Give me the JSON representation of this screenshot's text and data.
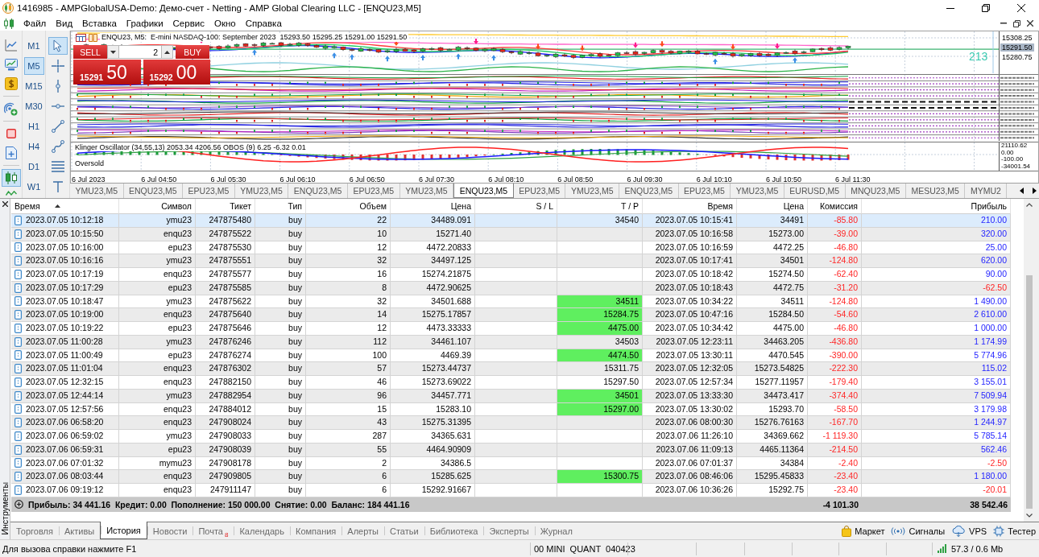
{
  "window": {
    "title": "1416985 - AMPGlobalUSA-Demo: Демо-счет - Netting - AMP Global Clearing LLC - [ENQU23,M5]"
  },
  "menu": [
    "Файл",
    "Вид",
    "Вставка",
    "Графики",
    "Сервис",
    "Окно",
    "Справка"
  ],
  "side_tools": [
    {
      "kind": "market-watch",
      "selected": false
    },
    {
      "kind": "data-window",
      "selected": false
    },
    {
      "kind": "trading",
      "selected": false
    },
    {
      "kind": "signals",
      "selected": false
    },
    {
      "kind": "stop",
      "selected": false
    },
    {
      "kind": "new-order",
      "selected": false
    },
    {
      "kind": "candles",
      "selected": true
    },
    {
      "kind": "oscillator",
      "selected": false
    }
  ],
  "timeframes": [
    {
      "label": "M1",
      "selected": false
    },
    {
      "label": "M5",
      "selected": true
    },
    {
      "label": "M15",
      "selected": false
    },
    {
      "label": "M30",
      "selected": false
    },
    {
      "label": "H1",
      "selected": false
    },
    {
      "label": "H4",
      "selected": false
    },
    {
      "label": "D1",
      "selected": false
    },
    {
      "label": "W1",
      "selected": false
    }
  ],
  "drawing_tools": [
    {
      "kind": "cursor",
      "selected": true
    },
    {
      "kind": "crosshair",
      "selected": false
    },
    {
      "kind": "vertical-line",
      "selected": false
    },
    {
      "kind": "horizontal-line",
      "selected": false
    },
    {
      "kind": "trend-line",
      "selected": false
    },
    {
      "kind": "polyline",
      "selected": false
    },
    {
      "kind": "parallel-lines",
      "selected": false
    },
    {
      "kind": "text",
      "selected": false
    }
  ],
  "chart": {
    "header": "ENQU23, M5:  E-mini NASDAQ-100: September 2023  15293.50 15295.25 15291.00 15291.50",
    "trade_panel": {
      "sell": "SELL",
      "volume": "2",
      "buy": "BUY",
      "bid": "15291",
      "bid_pips": "50",
      "ask": "15292",
      "ask_pips": "00"
    },
    "price_axis": [
      "15308.25",
      "15280.75"
    ],
    "current_price": "15291.50",
    "counter": "213",
    "oscillator": {
      "label": "Klinger Oscillator (34,55,13) 2053.34 4206.56 OBOS (9) 6.25 -6.32 0.01",
      "note": "Oversold",
      "axis": [
        "21110.62",
        "0.00",
        "-100.00",
        "-34001.54"
      ]
    },
    "time_axis": [
      "6 Jul 2023",
      "6 Jul 04:50",
      "6 Jul 05:30",
      "6 Jul 06:10",
      "6 Jul 06:50",
      "6 Jul 07:30",
      "6 Jul 08:10",
      "6 Jul 08:50",
      "6 Jul 09:30",
      "6 Jul 10:10",
      "6 Jul 10:50",
      "6 Jul 11:30"
    ]
  },
  "chart_tabs": [
    {
      "label": "YMU23,M5",
      "selected": false
    },
    {
      "label": "ENQU23,M5",
      "selected": false
    },
    {
      "label": "EPU23,M5",
      "selected": false
    },
    {
      "label": "YMU23,M5",
      "selected": false
    },
    {
      "label": "ENQU23,M5",
      "selected": false
    },
    {
      "label": "EPU23,M5",
      "selected": false
    },
    {
      "label": "YMU23,M5",
      "selected": false
    },
    {
      "label": "ENQU23,M5",
      "selected": true
    },
    {
      "label": "EPU23,M5",
      "selected": false
    },
    {
      "label": "YMU23,M5",
      "selected": false
    },
    {
      "label": "ENQU23,M5",
      "selected": false
    },
    {
      "label": "EPU23,M5",
      "selected": false
    },
    {
      "label": "YMU23,M5",
      "selected": false
    },
    {
      "label": "EURUSD,M5",
      "selected": false
    },
    {
      "label": "MNQU23,M5",
      "selected": false
    },
    {
      "label": "MESU23,M5",
      "selected": false
    },
    {
      "label": "MYMU2",
      "selected": false
    }
  ],
  "history": {
    "columns": [
      {
        "label": "Время",
        "sorted": true
      },
      {
        "label": "Символ",
        "sorted": false
      },
      {
        "label": "Тикет",
        "sorted": false
      },
      {
        "label": "Тип",
        "sorted": false
      },
      {
        "label": "Объем",
        "sorted": false
      },
      {
        "label": "Цена",
        "sorted": false
      },
      {
        "label": "S / L",
        "sorted": false
      },
      {
        "label": "T / P",
        "sorted": false
      },
      {
        "label": "Время",
        "sorted": false
      },
      {
        "label": "Цена",
        "sorted": false
      },
      {
        "label": "Комиссия",
        "sorted": false
      },
      {
        "label": "Прибыль",
        "sorted": false
      }
    ],
    "rows": [
      {
        "open_time": "2023.07.05 10:12:18",
        "symbol": "ymu23",
        "ticket": "247875480",
        "type": "buy",
        "volume": "22",
        "open_price": "34489.091",
        "tp": "34540",
        "close_time": "2023.07.05 10:15:41",
        "close_price": "34491",
        "commission": "-85.80",
        "profit": "210.00",
        "selected": true,
        "tp_hit": false,
        "loss": false
      },
      {
        "open_time": "2023.07.05 10:15:50",
        "symbol": "enqu23",
        "ticket": "247875522",
        "type": "buy",
        "volume": "10",
        "open_price": "15271.40",
        "close_time": "2023.07.05 10:16:58",
        "close_price": "15273.00",
        "commission": "-39.00",
        "profit": "320.00",
        "selected": false,
        "tp_hit": false,
        "loss": false
      },
      {
        "open_time": "2023.07.05 10:16:00",
        "symbol": "epu23",
        "ticket": "247875530",
        "type": "buy",
        "volume": "12",
        "open_price": "4472.20833",
        "close_time": "2023.07.05 10:16:59",
        "close_price": "4472.25",
        "commission": "-46.80",
        "profit": "25.00",
        "selected": false,
        "tp_hit": false,
        "loss": false
      },
      {
        "open_time": "2023.07.05 10:16:16",
        "symbol": "ymu23",
        "ticket": "247875551",
        "type": "buy",
        "volume": "32",
        "open_price": "34497.125",
        "close_time": "2023.07.05 10:17:41",
        "close_price": "34501",
        "commission": "-124.80",
        "profit": "620.00",
        "selected": false,
        "tp_hit": false,
        "loss": false
      },
      {
        "open_time": "2023.07.05 10:17:19",
        "symbol": "enqu23",
        "ticket": "247875577",
        "type": "buy",
        "volume": "16",
        "open_price": "15274.21875",
        "close_time": "2023.07.05 10:18:42",
        "close_price": "15274.50",
        "commission": "-62.40",
        "profit": "90.00",
        "selected": false,
        "tp_hit": false,
        "loss": false
      },
      {
        "open_time": "2023.07.05 10:17:29",
        "symbol": "epu23",
        "ticket": "247875585",
        "type": "buy",
        "volume": "8",
        "open_price": "4472.90625",
        "close_time": "2023.07.05 10:18:43",
        "close_price": "4472.75",
        "commission": "-31.20",
        "profit": "-62.50",
        "selected": false,
        "tp_hit": false,
        "loss": true
      },
      {
        "open_time": "2023.07.05 10:18:47",
        "symbol": "ymu23",
        "ticket": "247875622",
        "type": "buy",
        "volume": "32",
        "open_price": "34501.688",
        "tp": "34511",
        "close_time": "2023.07.05 10:34:22",
        "close_price": "34511",
        "commission": "-124.80",
        "profit": "1 490.00",
        "selected": false,
        "tp_hit": true,
        "loss": false
      },
      {
        "open_time": "2023.07.05 10:19:00",
        "symbol": "enqu23",
        "ticket": "247875640",
        "type": "buy",
        "volume": "14",
        "open_price": "15275.17857",
        "tp": "15284.75",
        "close_time": "2023.07.05 10:47:16",
        "close_price": "15284.50",
        "commission": "-54.60",
        "profit": "2 610.00",
        "selected": false,
        "tp_hit": true,
        "loss": false
      },
      {
        "open_time": "2023.07.05 10:19:22",
        "symbol": "epu23",
        "ticket": "247875646",
        "type": "buy",
        "volume": "12",
        "open_price": "4473.33333",
        "tp": "4475.00",
        "close_time": "2023.07.05 10:34:42",
        "close_price": "4475.00",
        "commission": "-46.80",
        "profit": "1 000.00",
        "selected": false,
        "tp_hit": true,
        "loss": false
      },
      {
        "open_time": "2023.07.05 11:00:28",
        "symbol": "ymu23",
        "ticket": "247876246",
        "type": "buy",
        "volume": "112",
        "open_price": "34461.107",
        "tp": "34503",
        "close_time": "2023.07.05 12:23:11",
        "close_price": "34463.205",
        "commission": "-436.80",
        "profit": "1 174.99",
        "selected": false,
        "tp_hit": false,
        "loss": false
      },
      {
        "open_time": "2023.07.05 11:00:49",
        "symbol": "epu23",
        "ticket": "247876274",
        "type": "buy",
        "volume": "100",
        "open_price": "4469.39",
        "tp": "4474.50",
        "close_time": "2023.07.05 13:30:11",
        "close_price": "4470.545",
        "commission": "-390.00",
        "profit": "5 774.96",
        "selected": false,
        "tp_hit": true,
        "loss": false
      },
      {
        "open_time": "2023.07.05 11:01:04",
        "symbol": "enqu23",
        "ticket": "247876302",
        "type": "buy",
        "volume": "57",
        "open_price": "15273.44737",
        "tp": "15311.75",
        "close_time": "2023.07.05 12:32:05",
        "close_price": "15273.54825",
        "commission": "-222.30",
        "profit": "115.02",
        "selected": false,
        "tp_hit": false,
        "loss": false
      },
      {
        "open_time": "2023.07.05 12:32:15",
        "symbol": "enqu23",
        "ticket": "247882150",
        "type": "buy",
        "volume": "46",
        "open_price": "15273.69022",
        "tp": "15297.50",
        "close_time": "2023.07.05 12:57:34",
        "close_price": "15277.11957",
        "commission": "-179.40",
        "profit": "3 155.01",
        "selected": false,
        "tp_hit": false,
        "loss": false
      },
      {
        "open_time": "2023.07.05 12:44:14",
        "symbol": "ymu23",
        "ticket": "247882954",
        "type": "buy",
        "volume": "96",
        "open_price": "34457.771",
        "tp": "34501",
        "close_time": "2023.07.05 13:33:30",
        "close_price": "34473.417",
        "commission": "-374.40",
        "profit": "7 509.94",
        "selected": false,
        "tp_hit": true,
        "loss": false
      },
      {
        "open_time": "2023.07.05 12:57:56",
        "symbol": "enqu23",
        "ticket": "247884012",
        "type": "buy",
        "volume": "15",
        "open_price": "15283.10",
        "tp": "15297.00",
        "close_time": "2023.07.05 13:30:02",
        "close_price": "15293.70",
        "commission": "-58.50",
        "profit": "3 179.98",
        "selected": false,
        "tp_hit": true,
        "loss": false
      },
      {
        "open_time": "2023.07.06 06:58:20",
        "symbol": "enqu23",
        "ticket": "247908024",
        "type": "buy",
        "volume": "43",
        "open_price": "15275.31395",
        "close_time": "2023.07.06 08:00:30",
        "close_price": "15276.76163",
        "commission": "-167.70",
        "profit": "1 244.97",
        "selected": false,
        "tp_hit": false,
        "loss": false
      },
      {
        "open_time": "2023.07.06 06:59:02",
        "symbol": "ymu23",
        "ticket": "247908033",
        "type": "buy",
        "volume": "287",
        "open_price": "34365.631",
        "close_time": "2023.07.06 11:26:10",
        "close_price": "34369.662",
        "commission": "-1 119.30",
        "profit": "5 785.14",
        "selected": false,
        "tp_hit": false,
        "loss": false
      },
      {
        "open_time": "2023.07.06 06:59:31",
        "symbol": "epu23",
        "ticket": "247908039",
        "type": "buy",
        "volume": "55",
        "open_price": "4464.90909",
        "close_time": "2023.07.06 11:09:13",
        "close_price": "4465.11364",
        "commission": "-214.50",
        "profit": "562.46",
        "selected": false,
        "tp_hit": false,
        "loss": false
      },
      {
        "open_time": "2023.07.06 07:01:32",
        "symbol": "mymu23",
        "ticket": "247908178",
        "type": "buy",
        "volume": "2",
        "open_price": "34386.5",
        "close_time": "2023.07.06 07:01:37",
        "close_price": "34384",
        "commission": "-2.40",
        "profit": "-2.50",
        "selected": false,
        "tp_hit": false,
        "loss": true
      },
      {
        "open_time": "2023.07.06 08:03:44",
        "symbol": "enqu23",
        "ticket": "247909805",
        "type": "buy",
        "volume": "6",
        "open_price": "15285.625",
        "tp": "15300.75",
        "close_time": "2023.07.06 08:46:06",
        "close_price": "15295.45833",
        "commission": "-23.40",
        "profit": "1 180.00",
        "selected": false,
        "tp_hit": true,
        "loss": false
      },
      {
        "open_time": "2023.07.06 09:19:12",
        "symbol": "enqu23",
        "ticket": "247911147",
        "type": "buy",
        "volume": "6",
        "open_price": "15292.91667",
        "close_time": "2023.07.06 10:36:26",
        "close_price": "15292.75",
        "commission": "-23.40",
        "profit": "-20.01",
        "selected": false,
        "tp_hit": false,
        "loss": true
      }
    ],
    "summary": {
      "text": "Прибыль: 34 441.16  Кредит: 0.00  Пополнение: 150 000.00  Снятие: 0.00  Баланс: 184 441.16",
      "commission": "-4 101.30",
      "profit": "38 542.46"
    }
  },
  "toolbox_label": "Инструменты",
  "bottom_tabs": [
    {
      "label": "Торговля",
      "selected": false
    },
    {
      "label": "Активы",
      "selected": false
    },
    {
      "label": "История",
      "selected": true
    },
    {
      "label": "Новости",
      "selected": false
    },
    {
      "label": "Почта",
      "selected": false,
      "badge": "8"
    },
    {
      "label": "Календарь",
      "selected": false
    },
    {
      "label": "Компания",
      "selected": false
    },
    {
      "label": "Алерты",
      "selected": false
    },
    {
      "label": "Статьи",
      "selected": false
    },
    {
      "label": "Библиотека",
      "selected": false
    },
    {
      "label": "Эксперты",
      "selected": false
    },
    {
      "label": "Журнал",
      "selected": false
    }
  ],
  "services": [
    {
      "kind": "market",
      "label": "Маркет"
    },
    {
      "kind": "signals",
      "label": "Сигналы"
    },
    {
      "kind": "vps",
      "label": "VPS"
    },
    {
      "kind": "tester",
      "label": "Тестер"
    }
  ],
  "status_bar": {
    "help": "Для вызова справки нажмите F1",
    "profile": "00 MINI  QUANT  040423",
    "traffic": "57.3 / 0.6 Mb"
  }
}
